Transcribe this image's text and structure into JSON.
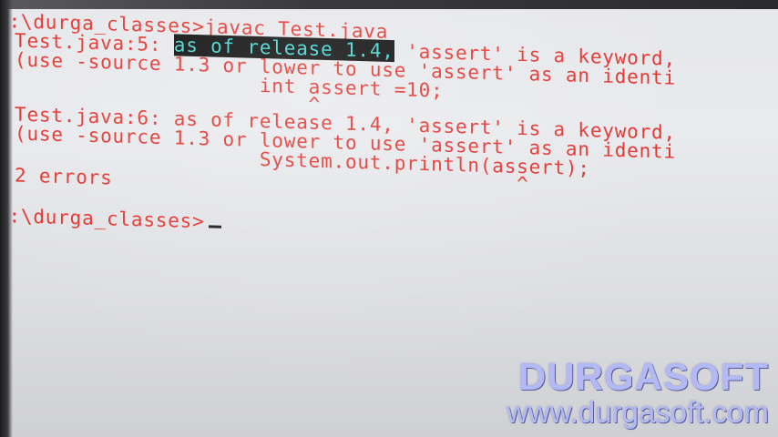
{
  "terminal": {
    "lines": [
      {
        "text": "C:\\durga_classes>javac Test.java"
      },
      {
        "pre": "Test.java:5: ",
        "highlight": "as of release 1.4,",
        "post": " 'assert' is a keyword,"
      },
      {
        "text": "(use -source 1.3 or lower to use 'assert' as an identi"
      },
      {
        "text": "                    int assert =10;"
      },
      {
        "text": "                        ^"
      },
      {
        "text": "Test.java:6: as of release 1.4, 'assert' is a keyword,"
      },
      {
        "text": "(use -source 1.3 or lower to use 'assert' as an identi"
      },
      {
        "text": "                    System.out.println(assert);"
      },
      {
        "text": "                                         ^"
      },
      {
        "text": "2 errors"
      },
      {
        "text": ""
      },
      {
        "text": "C:\\durga_classes>"
      }
    ]
  },
  "watermark": {
    "brand": "DURGASOFT",
    "url": "www.durgasoft.com"
  },
  "colors": {
    "terminal_text": "#e5322d",
    "highlight_text": "#3fd3cf",
    "highlight_bg": "#0a0a0a",
    "background": "#e6e7ea",
    "watermark": "#b3b9f4"
  }
}
